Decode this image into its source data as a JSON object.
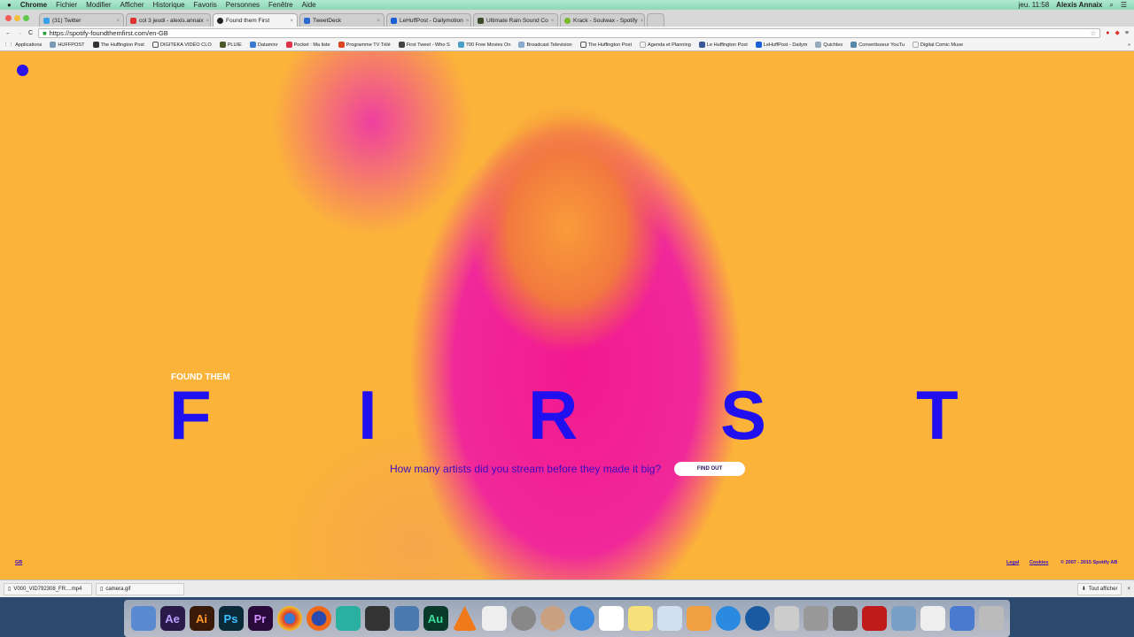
{
  "menubar": {
    "app": "Chrome",
    "items": [
      "Fichier",
      "Modifier",
      "Afficher",
      "Historique",
      "Favoris",
      "Personnes",
      "Fenêtre",
      "Aide"
    ],
    "clock": "jeu. 11:58",
    "user": "Alexis Annaix"
  },
  "tabs": [
    {
      "label": "(31) Twitter",
      "color": "#3aa0e8"
    },
    {
      "label": "col 3 jeudi - alexis.annaix",
      "color": "#d33"
    },
    {
      "label": "Found them First",
      "color": "#222"
    },
    {
      "label": "TweetDeck",
      "color": "#2a6bd0"
    },
    {
      "label": "LeHuffPost - Dailymotion",
      "color": "#1a5fd6"
    },
    {
      "label": "Ultimate Rain Sound Co",
      "color": "#3a4a2a"
    },
    {
      "label": "Krack - Soulwax - Spotify",
      "color": "#7ab82a"
    }
  ],
  "address": {
    "url": "https://spotify-foundthemfirst.com/en-GB"
  },
  "bookmarks": [
    "Applications",
    "HUFFPOST",
    "The Huffington Post",
    "DIGITEKA VIDÉO CLO",
    "PLUIE",
    "Dataminr",
    "Pocket : Ma liste",
    "Programme TV Télé",
    "First Tweet - Who S",
    "700 Free Movies On",
    "Broadcast Television",
    "The Huffington Post",
    "Agenda et Planning",
    "Le Huffington Post",
    "LeHuffPost - Dailym",
    "Quichles",
    "Convertisseur YouTu",
    "Digital Comic Muse"
  ],
  "hero": {
    "kicker": "FOUND THEM",
    "letters": [
      "F",
      "I",
      "R",
      "S",
      "T"
    ],
    "question": "How many artists did you stream before they made it big?",
    "cta": "FIND OUT"
  },
  "footer": {
    "locale": "GB",
    "legal": "Legal",
    "cookies": "Cookies",
    "copyright": "© 2007 - 2015 Spotify AB"
  },
  "downloads": {
    "items": [
      "V000_VID792308_FR....mp4",
      "camera.gif"
    ],
    "show_all": "Tout afficher"
  },
  "dock": [
    {
      "label": "Ae",
      "color": "#2a1a4a"
    },
    {
      "label": "Ai",
      "color": "#3a1a08"
    },
    {
      "label": "Ps",
      "color": "#0a2a3a"
    },
    {
      "label": "Pr",
      "color": "#2a0a3a"
    },
    {
      "label": "Au",
      "color": "#0a3a2a"
    }
  ]
}
